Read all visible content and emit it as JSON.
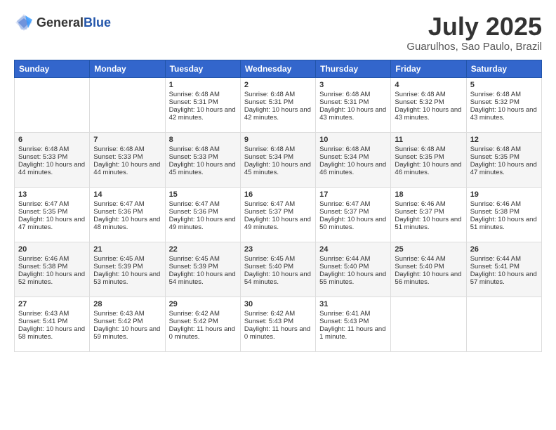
{
  "header": {
    "logo_general": "General",
    "logo_blue": "Blue",
    "title": "July 2025",
    "subtitle": "Guarulhos, Sao Paulo, Brazil"
  },
  "days_of_week": [
    "Sunday",
    "Monday",
    "Tuesday",
    "Wednesday",
    "Thursday",
    "Friday",
    "Saturday"
  ],
  "weeks": [
    [
      {
        "day": "",
        "sunrise": "",
        "sunset": "",
        "daylight": ""
      },
      {
        "day": "",
        "sunrise": "",
        "sunset": "",
        "daylight": ""
      },
      {
        "day": "1",
        "sunrise": "Sunrise: 6:48 AM",
        "sunset": "Sunset: 5:31 PM",
        "daylight": "Daylight: 10 hours and 42 minutes."
      },
      {
        "day": "2",
        "sunrise": "Sunrise: 6:48 AM",
        "sunset": "Sunset: 5:31 PM",
        "daylight": "Daylight: 10 hours and 42 minutes."
      },
      {
        "day": "3",
        "sunrise": "Sunrise: 6:48 AM",
        "sunset": "Sunset: 5:31 PM",
        "daylight": "Daylight: 10 hours and 43 minutes."
      },
      {
        "day": "4",
        "sunrise": "Sunrise: 6:48 AM",
        "sunset": "Sunset: 5:32 PM",
        "daylight": "Daylight: 10 hours and 43 minutes."
      },
      {
        "day": "5",
        "sunrise": "Sunrise: 6:48 AM",
        "sunset": "Sunset: 5:32 PM",
        "daylight": "Daylight: 10 hours and 43 minutes."
      }
    ],
    [
      {
        "day": "6",
        "sunrise": "Sunrise: 6:48 AM",
        "sunset": "Sunset: 5:33 PM",
        "daylight": "Daylight: 10 hours and 44 minutes."
      },
      {
        "day": "7",
        "sunrise": "Sunrise: 6:48 AM",
        "sunset": "Sunset: 5:33 PM",
        "daylight": "Daylight: 10 hours and 44 minutes."
      },
      {
        "day": "8",
        "sunrise": "Sunrise: 6:48 AM",
        "sunset": "Sunset: 5:33 PM",
        "daylight": "Daylight: 10 hours and 45 minutes."
      },
      {
        "day": "9",
        "sunrise": "Sunrise: 6:48 AM",
        "sunset": "Sunset: 5:34 PM",
        "daylight": "Daylight: 10 hours and 45 minutes."
      },
      {
        "day": "10",
        "sunrise": "Sunrise: 6:48 AM",
        "sunset": "Sunset: 5:34 PM",
        "daylight": "Daylight: 10 hours and 46 minutes."
      },
      {
        "day": "11",
        "sunrise": "Sunrise: 6:48 AM",
        "sunset": "Sunset: 5:35 PM",
        "daylight": "Daylight: 10 hours and 46 minutes."
      },
      {
        "day": "12",
        "sunrise": "Sunrise: 6:48 AM",
        "sunset": "Sunset: 5:35 PM",
        "daylight": "Daylight: 10 hours and 47 minutes."
      }
    ],
    [
      {
        "day": "13",
        "sunrise": "Sunrise: 6:47 AM",
        "sunset": "Sunset: 5:35 PM",
        "daylight": "Daylight: 10 hours and 47 minutes."
      },
      {
        "day": "14",
        "sunrise": "Sunrise: 6:47 AM",
        "sunset": "Sunset: 5:36 PM",
        "daylight": "Daylight: 10 hours and 48 minutes."
      },
      {
        "day": "15",
        "sunrise": "Sunrise: 6:47 AM",
        "sunset": "Sunset: 5:36 PM",
        "daylight": "Daylight: 10 hours and 49 minutes."
      },
      {
        "day": "16",
        "sunrise": "Sunrise: 6:47 AM",
        "sunset": "Sunset: 5:37 PM",
        "daylight": "Daylight: 10 hours and 49 minutes."
      },
      {
        "day": "17",
        "sunrise": "Sunrise: 6:47 AM",
        "sunset": "Sunset: 5:37 PM",
        "daylight": "Daylight: 10 hours and 50 minutes."
      },
      {
        "day": "18",
        "sunrise": "Sunrise: 6:46 AM",
        "sunset": "Sunset: 5:37 PM",
        "daylight": "Daylight: 10 hours and 51 minutes."
      },
      {
        "day": "19",
        "sunrise": "Sunrise: 6:46 AM",
        "sunset": "Sunset: 5:38 PM",
        "daylight": "Daylight: 10 hours and 51 minutes."
      }
    ],
    [
      {
        "day": "20",
        "sunrise": "Sunrise: 6:46 AM",
        "sunset": "Sunset: 5:38 PM",
        "daylight": "Daylight: 10 hours and 52 minutes."
      },
      {
        "day": "21",
        "sunrise": "Sunrise: 6:45 AM",
        "sunset": "Sunset: 5:39 PM",
        "daylight": "Daylight: 10 hours and 53 minutes."
      },
      {
        "day": "22",
        "sunrise": "Sunrise: 6:45 AM",
        "sunset": "Sunset: 5:39 PM",
        "daylight": "Daylight: 10 hours and 54 minutes."
      },
      {
        "day": "23",
        "sunrise": "Sunrise: 6:45 AM",
        "sunset": "Sunset: 5:40 PM",
        "daylight": "Daylight: 10 hours and 54 minutes."
      },
      {
        "day": "24",
        "sunrise": "Sunrise: 6:44 AM",
        "sunset": "Sunset: 5:40 PM",
        "daylight": "Daylight: 10 hours and 55 minutes."
      },
      {
        "day": "25",
        "sunrise": "Sunrise: 6:44 AM",
        "sunset": "Sunset: 5:40 PM",
        "daylight": "Daylight: 10 hours and 56 minutes."
      },
      {
        "day": "26",
        "sunrise": "Sunrise: 6:44 AM",
        "sunset": "Sunset: 5:41 PM",
        "daylight": "Daylight: 10 hours and 57 minutes."
      }
    ],
    [
      {
        "day": "27",
        "sunrise": "Sunrise: 6:43 AM",
        "sunset": "Sunset: 5:41 PM",
        "daylight": "Daylight: 10 hours and 58 minutes."
      },
      {
        "day": "28",
        "sunrise": "Sunrise: 6:43 AM",
        "sunset": "Sunset: 5:42 PM",
        "daylight": "Daylight: 10 hours and 59 minutes."
      },
      {
        "day": "29",
        "sunrise": "Sunrise: 6:42 AM",
        "sunset": "Sunset: 5:42 PM",
        "daylight": "Daylight: 11 hours and 0 minutes."
      },
      {
        "day": "30",
        "sunrise": "Sunrise: 6:42 AM",
        "sunset": "Sunset: 5:43 PM",
        "daylight": "Daylight: 11 hours and 0 minutes."
      },
      {
        "day": "31",
        "sunrise": "Sunrise: 6:41 AM",
        "sunset": "Sunset: 5:43 PM",
        "daylight": "Daylight: 11 hours and 1 minute."
      },
      {
        "day": "",
        "sunrise": "",
        "sunset": "",
        "daylight": ""
      },
      {
        "day": "",
        "sunrise": "",
        "sunset": "",
        "daylight": ""
      }
    ]
  ]
}
